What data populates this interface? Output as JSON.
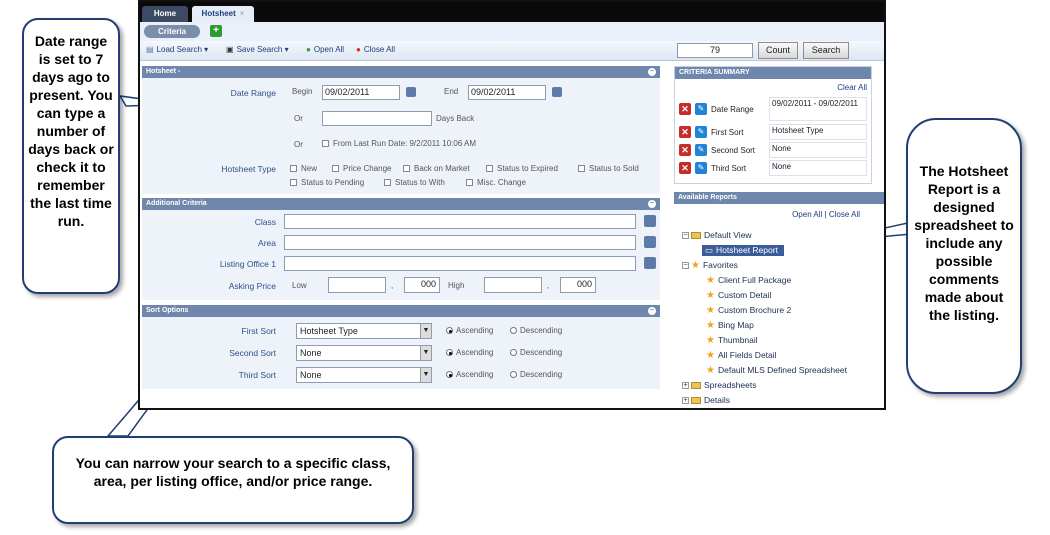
{
  "tabs": {
    "home": "Home",
    "hotsheet": "Hotsheet",
    "close": "×"
  },
  "criteria_pill": "Criteria",
  "toolbar": {
    "load_search": "Load Search",
    "save_search": "Save Search",
    "open_all": "Open All",
    "close_all": "Close All",
    "count_value": "79",
    "count_label": "Count",
    "search_label": "Search"
  },
  "hotsheet_panel": {
    "title": "Hotsheet -",
    "date_range_label": "Date Range",
    "begin_label": "Begin",
    "begin_value": "09/02/2011",
    "end_label": "End",
    "end_value": "09/02/2011",
    "or1": "Or",
    "days_back_label": "Days Back",
    "or2": "Or",
    "from_last_run": "From Last Run Date: 9/2/2011 10:06 AM",
    "hotsheet_type_label": "Hotsheet Type",
    "types": [
      "New",
      "Price Change",
      "Back on Market",
      "Status to Expired",
      "Status to Sold",
      "Status to Pending",
      "Status to With",
      "Misc. Change"
    ]
  },
  "additional_panel": {
    "title": "Additional Criteria",
    "class_label": "Class",
    "area_label": "Area",
    "listing_office_label": "Listing Office 1",
    "asking_price_label": "Asking Price",
    "low_label": "Low",
    "high_label": "High",
    "low_suffix": "000",
    "high_suffix": "000",
    "comma": ","
  },
  "sort_panel": {
    "title": "Sort Options",
    "rows": [
      {
        "label": "First Sort",
        "value": "Hotsheet Type",
        "asc": "Ascending",
        "desc": "Descending"
      },
      {
        "label": "Second Sort",
        "value": "None",
        "asc": "Ascending",
        "desc": "Descending"
      },
      {
        "label": "Third Sort",
        "value": "None",
        "asc": "Ascending",
        "desc": "Descending"
      }
    ]
  },
  "summary_panel": {
    "title": "CRITERIA SUMMARY",
    "clear_all": "Clear All",
    "rows": [
      {
        "label": "Date Range",
        "value": "09/02/2011 - 09/02/2011"
      },
      {
        "label": "First Sort",
        "value": "Hotsheet Type"
      },
      {
        "label": "Second Sort",
        "value": "None"
      },
      {
        "label": "Third Sort",
        "value": "None"
      }
    ]
  },
  "reports_panel": {
    "title": "Available Reports",
    "open_all": "Open All",
    "separator": "|",
    "close_all": "Close All",
    "default_view": "Default View",
    "hotsheet_report": "Hotsheet Report",
    "favorites": "Favorites",
    "favorite_items": [
      "Client Full Package",
      "Custom Detail",
      "Custom Brochure 2",
      "Bing Map",
      "Thumbnail",
      "All Fields Detail",
      "Default MLS Defined Spreadsheet"
    ],
    "spreadsheets": "Spreadsheets",
    "details": "Details"
  },
  "callouts": {
    "left": "Date range is set to 7 days ago to present. You can type a number of days back or check it to remember the last time run.",
    "right": "The Hotsheet Report is a designed spreadsheet to include any possible comments made about the listing.",
    "bottom": "You can narrow your search to a specific class, area, per listing office, and/or price range."
  }
}
